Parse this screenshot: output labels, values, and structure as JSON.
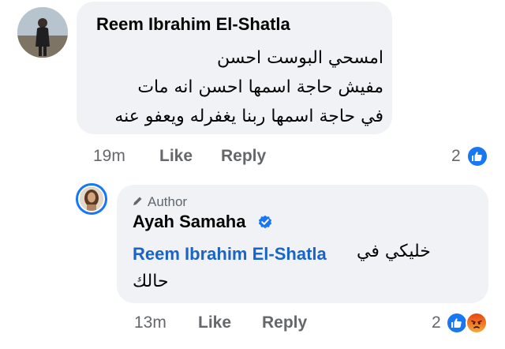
{
  "comment": {
    "author": "Reem Ibrahim El-Shatla",
    "lines": [
      "امسحي البوست احسن",
      "مفيش حاجة اسمها احسن انه مات",
      "في حاجة اسمها ربنا يغفرله ويعفو عنه"
    ],
    "time": "19m",
    "like_label": "Like",
    "reply_label": "Reply",
    "reaction_count": "2",
    "reactions": [
      "like-icon"
    ]
  },
  "reply": {
    "tag": "Author",
    "author": "Ayah Samaha",
    "verified": true,
    "mention": "Reem Ibrahim El-Shatla",
    "text_1": "خليكي في",
    "text_2": "حالك",
    "time": "13m",
    "like_label": "Like",
    "reply_label": "Reply",
    "reaction_count": "2",
    "reactions": [
      "like-icon",
      "angry-icon"
    ]
  },
  "colors": {
    "bubble": "#f0f2f5",
    "accent": "#1877f2",
    "mention": "#1a63c9",
    "meta": "#65676b"
  }
}
